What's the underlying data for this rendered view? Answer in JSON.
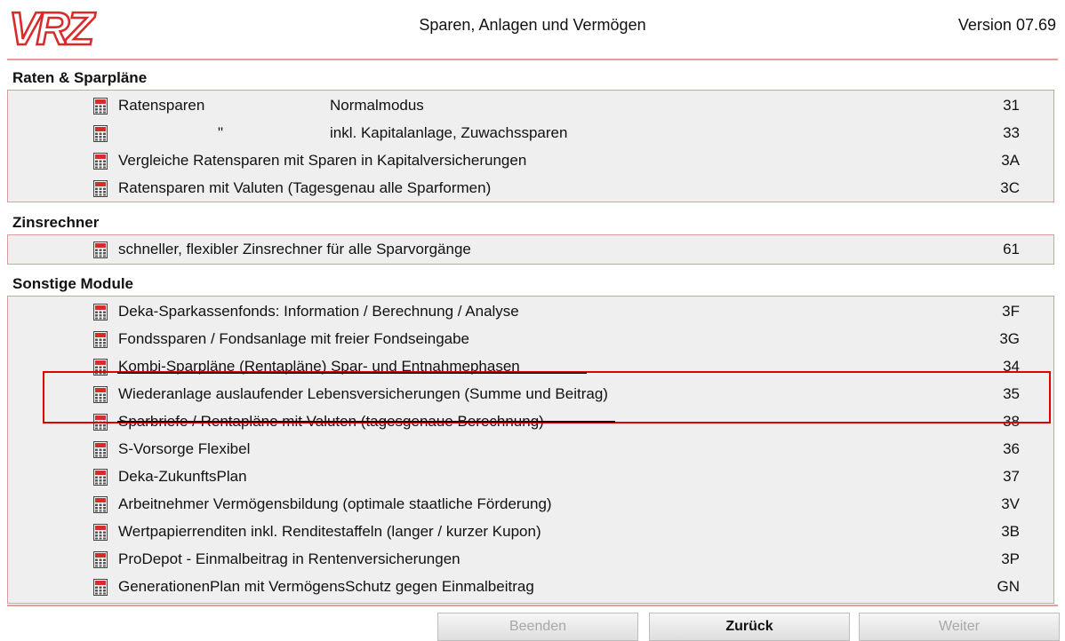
{
  "header": {
    "logo_text": "VRZ",
    "title": "Sparen, Anlagen und Vermögen",
    "version": "Version 07.69"
  },
  "sections": [
    {
      "title": "Raten & Sparpläne",
      "rows": [
        {
          "label": "Ratensparen",
          "label2": "Normalmodus",
          "code": "31"
        },
        {
          "label": "\"",
          "label2": "inkl. Kapitalanlage, Zuwachssparen",
          "code": "33"
        },
        {
          "label": "Vergleiche Ratensparen mit Sparen in Kapitalversicherungen",
          "label2": "",
          "code": "3A"
        },
        {
          "label": "Ratensparen mit Valuten (Tagesgenau alle Sparformen)",
          "label2": "",
          "code": "3C"
        }
      ]
    },
    {
      "title": "Zinsrechner",
      "rows": [
        {
          "label": "schneller, flexibler Zinsrechner für alle Sparvorgänge",
          "label2": "",
          "code": "61"
        }
      ]
    },
    {
      "title": "Sonstige Module",
      "rows": [
        {
          "label": "Deka-Sparkassenfonds: Information / Berechnung / Analyse",
          "label2": "",
          "code": "3F"
        },
        {
          "label": "Fondssparen / Fondsanlage mit freier Fondseingabe",
          "label2": "",
          "code": "3G"
        },
        {
          "label": "Kombi-Sparpläne (Rentapläne) Spar- und Entnahmephasen",
          "label2": "",
          "code": "34"
        },
        {
          "label": "Wiederanlage auslaufender Lebensversicherungen (Summe und Beitrag)",
          "label2": "",
          "code": "35"
        },
        {
          "label": "Sparbriefe / Rentapläne mit Valuten (tagesgenaue Berechnung)",
          "label2": "",
          "code": "38"
        },
        {
          "label": "S-Vorsorge Flexibel",
          "label2": "",
          "code": "36"
        },
        {
          "label": "Deka-ZukunftsPlan",
          "label2": "",
          "code": "37"
        },
        {
          "label": "Arbeitnehmer Vermögensbildung (optimale staatliche Förderung)",
          "label2": "",
          "code": "3V"
        },
        {
          "label": "Wertpapierrenditen inkl. Renditestaffeln (langer / kurzer Kupon)",
          "label2": "",
          "code": "3B"
        },
        {
          "label": "ProDepot - Einmalbeitrag in Rentenversicherungen",
          "label2": "",
          "code": "3P"
        },
        {
          "label": "GenerationenPlan mit VermögensSchutz gegen Einmalbeitrag",
          "label2": "",
          "code": "GN"
        }
      ]
    }
  ],
  "buttons": {
    "beenden": "Beenden",
    "zurueck": "Zurück",
    "weiter": "Weiter"
  },
  "colors": {
    "accent": "#d92b2b",
    "panel_border": "#df9a9a",
    "panel_bg": "#f0efef",
    "highlight": "#e00000"
  }
}
